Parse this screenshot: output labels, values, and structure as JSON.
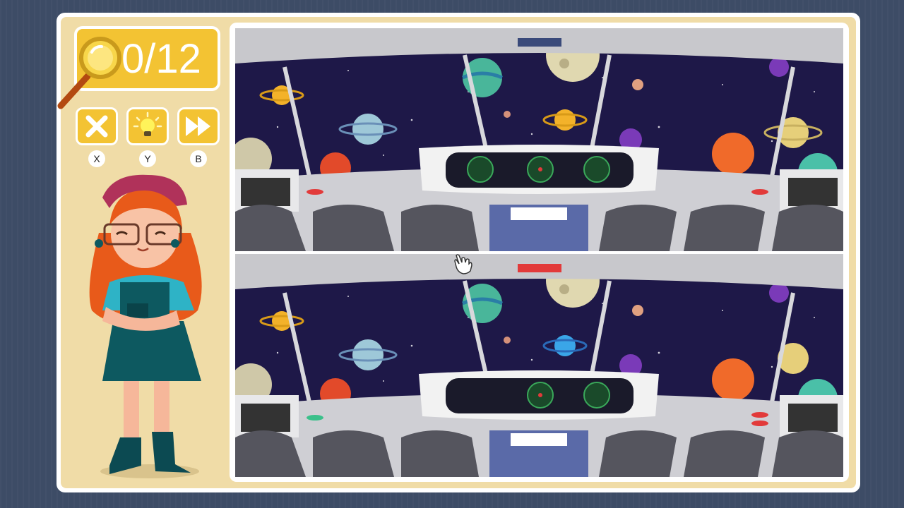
{
  "hud": {
    "counter_text": "0/12",
    "found": 0,
    "total": 12
  },
  "buttons": {
    "close": {
      "key_label": "X",
      "icon": "close-icon"
    },
    "hint": {
      "key_label": "Y",
      "icon": "lightbulb-icon"
    },
    "skip": {
      "key_label": "B",
      "icon": "fast-forward-icon"
    }
  },
  "colors": {
    "accent": "#f3c333",
    "panel": "#f0dca7",
    "background": "#3d4c66",
    "space": "#1e1848"
  }
}
